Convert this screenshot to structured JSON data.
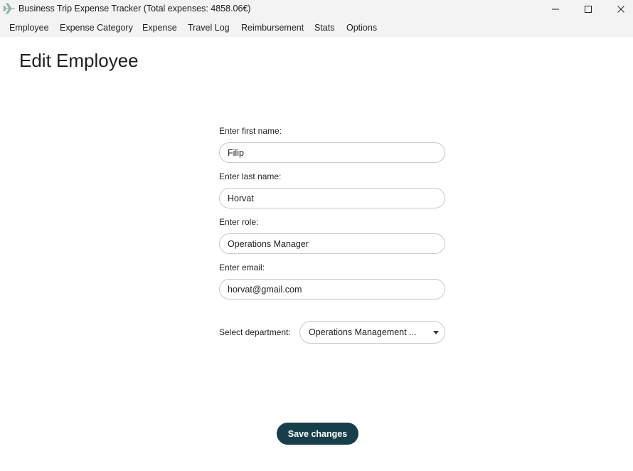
{
  "window": {
    "title": "Business Trip Expense Tracker (Total expenses: 4858.06€)",
    "icon": "airplane-icon"
  },
  "menu": {
    "items": [
      "Employee",
      "Expense Category",
      "Expense",
      "Travel Log",
      "Reimbursement",
      "Stats",
      "Options"
    ]
  },
  "page": {
    "title": "Edit Employee"
  },
  "form": {
    "first_name_label": "Enter first name:",
    "first_name_value": "Filip",
    "last_name_label": "Enter last name:",
    "last_name_value": "Horvat",
    "role_label": "Enter role:",
    "role_value": "Operations Manager",
    "email_label": "Enter email:",
    "email_value": "horvat@gmail.com",
    "department_label": "Select department:",
    "department_value": "Operations Management ...",
    "save_label": "Save changes"
  },
  "colors": {
    "accent": "#173e4b",
    "chrome": "#f3f3f3",
    "input_border": "#c9c9c9"
  }
}
